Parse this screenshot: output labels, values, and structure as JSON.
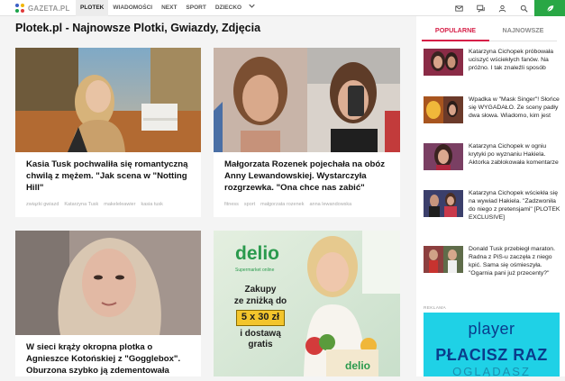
{
  "topnav": {
    "logo_text": "GAZETA.PL",
    "items": [
      {
        "label": "PLOTEK",
        "active": true
      },
      {
        "label": "WIADOMOŚCI",
        "active": false
      },
      {
        "label": "NEXT",
        "active": false
      },
      {
        "label": "SPORT",
        "active": false
      },
      {
        "label": "DZIECKO",
        "active": false
      }
    ],
    "icons": [
      "mail-icon",
      "chat-icon",
      "user-icon",
      "search-icon",
      "leaf-icon"
    ],
    "accent": "#29a745"
  },
  "page": {
    "title": "Plotek.pl - Najnowsze Plotki, Gwiazdy, Zdjęcia"
  },
  "articles": [
    {
      "title": "Kasia Tusk pochwaliła się romantyczną chwilą z mężem. \"Jak scena w \"Notting Hill\"",
      "tags": [
        "związki gwiazd",
        "Katarzyna Tusk",
        "makeleleawier",
        "kasia tusk"
      ]
    },
    {
      "title": "Małgorzata Rozenek pojechała na obóz Anny Lewandowskiej. Wystarczyła rozgrzewka. \"Ona chce nas zabić\"",
      "tags": [
        "fitness",
        "sport",
        "małgorzata rozenek",
        "anna lewandowska"
      ]
    },
    {
      "title": "W sieci krąży okropna plotka o Agnieszce Kotońskiej z \"Gogglebox\". Oburzona szybko ją zdementowała",
      "tags": []
    },
    {
      "title": "",
      "tags": [],
      "ad": {
        "brand": "delio",
        "brand_sub": "Supermarket online",
        "line1": "Zakupy",
        "line2": "ze zniżką do",
        "price": "5 x 30 zł",
        "line3": "i dostawą",
        "line4": "gratis",
        "bag_brand": "delio"
      }
    }
  ],
  "sidebar": {
    "tabs": [
      {
        "label": "POPULARNE",
        "active": true
      },
      {
        "label": "NAJNOWSZE",
        "active": false
      }
    ],
    "accent": "#d61f47",
    "items": [
      {
        "text": "Katarzyna Cichopek próbowała uciszyć wściekłych fanów. Na próżno. I tak znaleźli sposób"
      },
      {
        "text": "Wpadka w \"Mask Singer\"! Słońce się WYGADAŁO. Ze sceny padły dwa słowa. Wiadomo, kim jest"
      },
      {
        "text": "Katarzyna Cichopek w ogniu krytyki po wyznaniu Hakiela. Aktorka zablokowała komentarze"
      },
      {
        "text": "Katarzyna Cichopek wściekła się na wywiad Hakiela. \"Zadzwoniła do niego z pretensjami\" [PLOTEK EXCLUSIVE]"
      },
      {
        "text": "Donald Tusk przebiegł maraton. Radna z PiS-u zaczęła z niego kpić. Sama się ośmieszyła. \"Ogarnia pani już przecenty?\""
      }
    ],
    "reklama_label": "REKLAMA",
    "ad": {
      "brand": "player",
      "headline": "PŁACISZ RAZ",
      "sub": "OGLĄDASZ",
      "bg": "#1fd1e6"
    }
  }
}
